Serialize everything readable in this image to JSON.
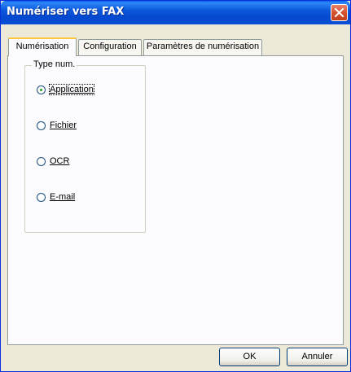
{
  "window": {
    "title": "Numériser vers FAX",
    "close_icon": "close-icon"
  },
  "tabs": [
    {
      "label": "Numérisation",
      "active": true
    },
    {
      "label": "Configuration",
      "active": false
    },
    {
      "label": "Paramètres de numérisation",
      "active": false
    }
  ],
  "group": {
    "label": "Type num."
  },
  "radios": [
    {
      "label": "Application",
      "selected": true
    },
    {
      "label": "Fichier",
      "selected": false
    },
    {
      "label": "OCR",
      "selected": false
    },
    {
      "label": "E-mail",
      "selected": false
    }
  ],
  "buttons": {
    "ok": "OK",
    "cancel": "Annuler"
  },
  "colors": {
    "titlebar": "#0a4fd6",
    "dialog_bg": "#ece9d8",
    "selected_dot": "#21a121"
  }
}
